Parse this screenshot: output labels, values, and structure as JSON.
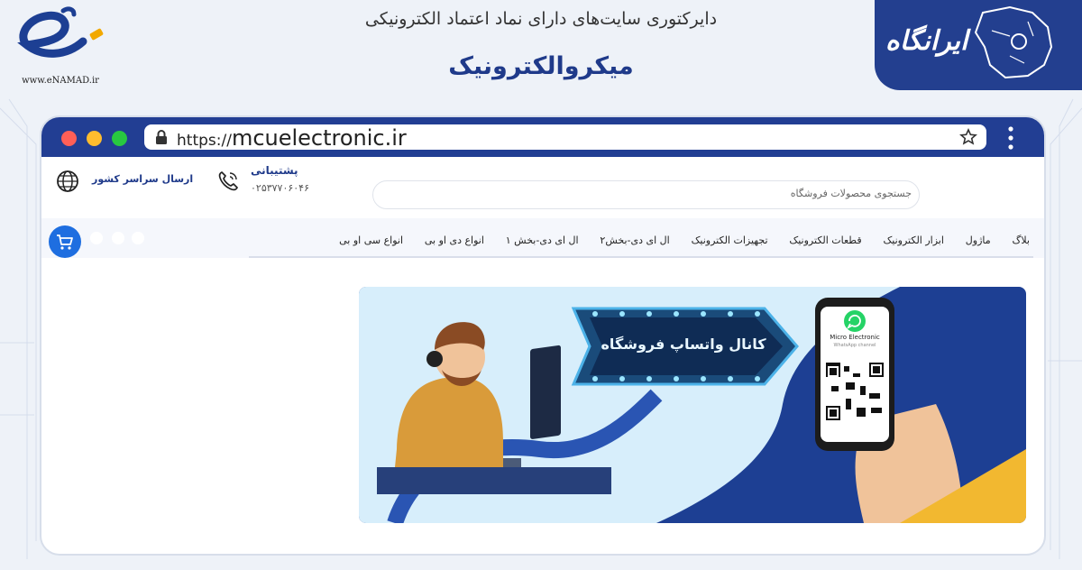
{
  "header": {
    "enamad_url": "www.eNAMAD.ir",
    "subtitle": "دایرکتوری سایت‌های دارای نماد اعتماد الکترونیکی",
    "title": "میکروالکترونیک",
    "brand_text": "ایرانگاه"
  },
  "browser": {
    "url_prefix": "https://",
    "url_domain": "mcuelectronic.ir"
  },
  "site": {
    "support_title": "پشتیبانی",
    "support_phone": "۰۲۵۳۷۷۰۶۰۴۶",
    "shipping_text": "ارسال سراسر کشور",
    "search_placeholder": "جستجوی محصولات فروشگاه",
    "menu": [
      {
        "label": "انواع سی او بی"
      },
      {
        "label": "انواع دی او بی"
      },
      {
        "label": "ال ای دی-بخش ۱"
      },
      {
        "label": "ال ای دی-بخش۲"
      },
      {
        "label": "تجهیزات الکترونیک"
      },
      {
        "label": "قطعات الکترونیک"
      },
      {
        "label": "ابزار الکترونیک"
      },
      {
        "label": "ماژول"
      },
      {
        "label": "بلاگ"
      }
    ]
  },
  "banner": {
    "sign_text": "کانال واتساپ فروشگاه",
    "phone_name": "Micro Electronic",
    "phone_sub": "WhatsApp channel"
  },
  "colors": {
    "brand_blue": "#223e93",
    "cart_blue": "#1e6ee0",
    "banner_light": "#d7eefb",
    "dot_red": "#ff5f57",
    "dot_yellow": "#febc2e",
    "dot_green": "#28c840"
  }
}
